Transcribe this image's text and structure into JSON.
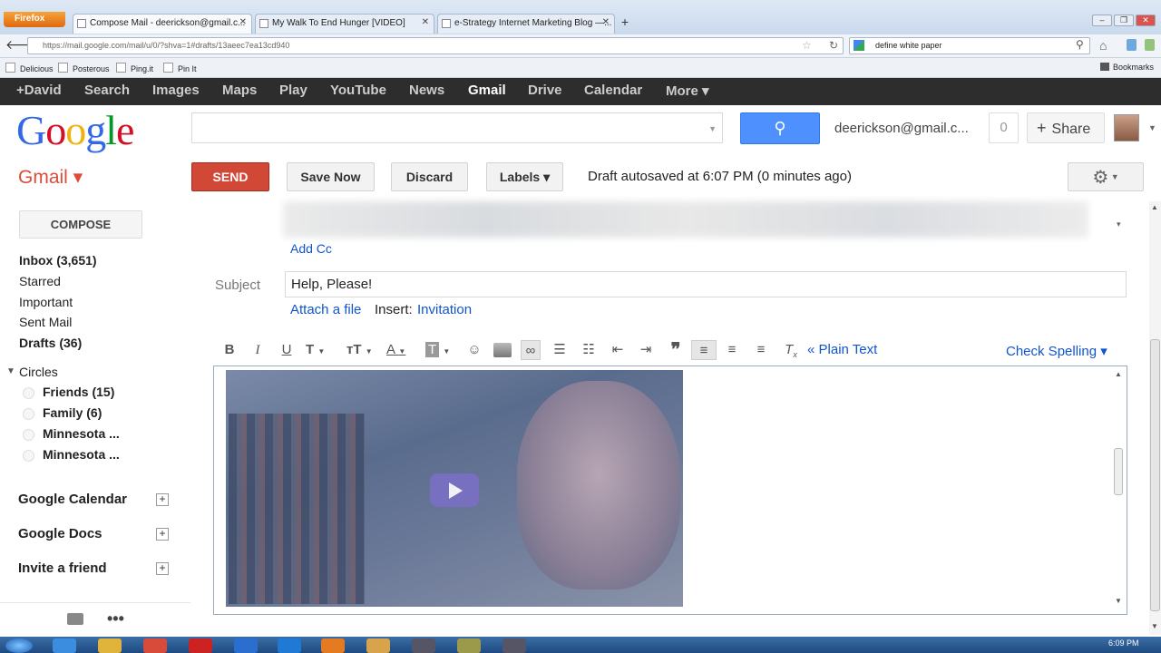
{
  "browser": {
    "menu_label": "Firefox",
    "tabs": [
      {
        "label": "Compose Mail - deerickson@gmail.c...",
        "active": true
      },
      {
        "label": "My Walk To End Hunger [VIDEO]",
        "active": false
      },
      {
        "label": "e-Strategy Internet Marketing Blog —...",
        "active": false
      }
    ],
    "url": "https://mail.google.com/mail/u/0/?shva=1#drafts/13aeec7ea13cd940",
    "search_value": "define white paper",
    "bookmarks": [
      "Delicious",
      "Posterous",
      "Ping.it",
      "Pin It"
    ],
    "bookmarks_menu": "Bookmarks"
  },
  "google_bar": {
    "items": [
      "+David",
      "Search",
      "Images",
      "Maps",
      "Play",
      "YouTube",
      "News",
      "Gmail",
      "Drive",
      "Calendar",
      "More ▾"
    ],
    "selected": "Gmail"
  },
  "header": {
    "account_email": "deerickson@gmail.c...",
    "notification_count": "0",
    "share_label": "Share"
  },
  "toolbar": {
    "app_label": "Gmail ▾",
    "send": "SEND",
    "save_now": "Save Now",
    "discard": "Discard",
    "labels": "Labels ▾",
    "draft_status": "Draft autosaved at 6:07 PM (0 minutes ago)"
  },
  "sidebar": {
    "compose": "COMPOSE",
    "folders": [
      {
        "label": "Inbox (3,651)",
        "bold": true
      },
      {
        "label": "Starred",
        "bold": false
      },
      {
        "label": "Important",
        "bold": false
      },
      {
        "label": "Sent Mail",
        "bold": false
      },
      {
        "label": "Drafts (36)",
        "bold": true
      }
    ],
    "circles_label": "Circles",
    "circles": [
      "Friends (15)",
      "Family (6)",
      "Minnesota ...",
      "Minnesota ..."
    ],
    "links": [
      "Google Calendar",
      "Google Docs",
      "Invite a friend"
    ]
  },
  "compose": {
    "add_cc": "Add Cc",
    "subject_label": "Subject",
    "subject_value": "Help, Please!",
    "attach": "Attach a file",
    "insert_label": "Insert:",
    "insert_invitation": "Invitation",
    "plain_text": "« Plain Text",
    "check_spelling": "Check Spelling ▾"
  },
  "taskbar": {
    "clock": "6:09 PM"
  },
  "colors": {
    "send": "#d14836",
    "search_button": "#4d90fe",
    "gmail_red": "#dd4b39",
    "link": "#1155cc",
    "google_bar": "#2d2d2d"
  }
}
